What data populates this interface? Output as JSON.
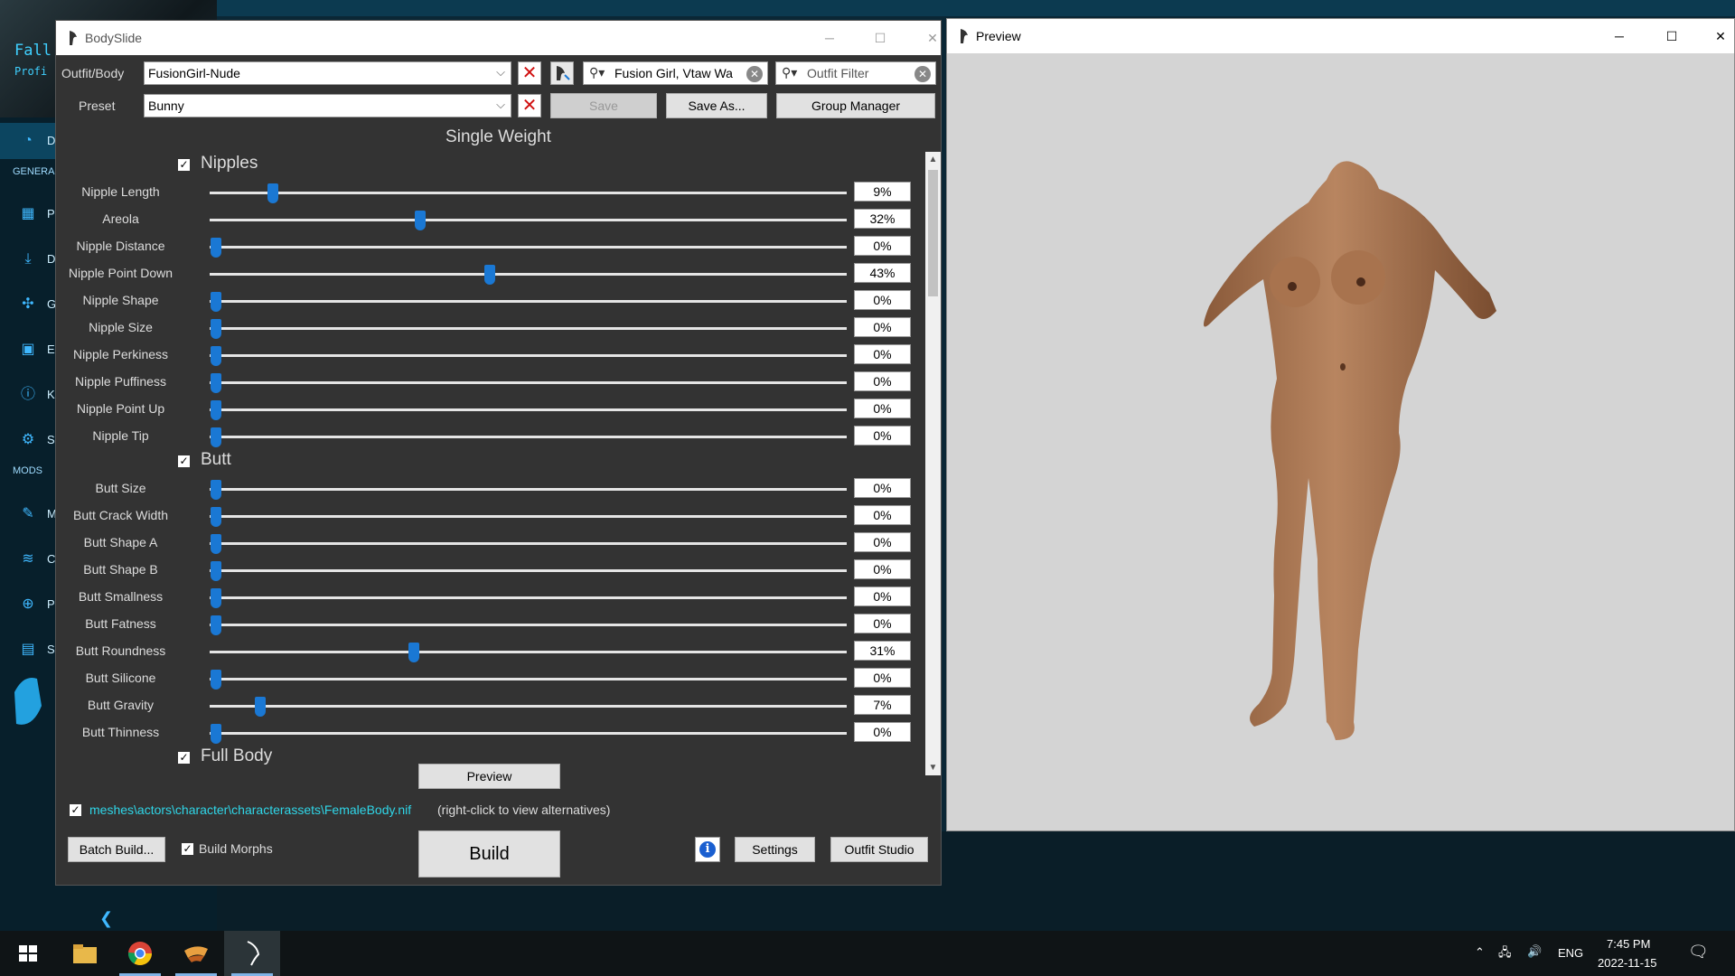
{
  "background_app": {
    "title": "Fall",
    "subtitle": "Profi",
    "active_item": "D",
    "section_general": "GENERA",
    "section_mods": "MODS",
    "items_general": [
      "P",
      "D",
      "G",
      "E",
      "K",
      "S"
    ],
    "items_mods": [
      "M",
      "C",
      "P",
      "S"
    ]
  },
  "bodyslide": {
    "title": "BodySlide",
    "outfit_label": "Outfit/Body",
    "outfit_value": "FusionGirl-Nude",
    "preset_label": "Preset",
    "preset_value": "Bunny",
    "group_filter": "Fusion Girl, Vtaw Wa",
    "outfit_filter_placeholder": "Outfit Filter",
    "save_label": "Save",
    "save_as_label": "Save As...",
    "group_manager_label": "Group Manager",
    "section_title": "Single Weight",
    "groups": [
      {
        "name": "Nipples",
        "checked": true,
        "sliders": [
          {
            "label": "Nipple Length",
            "value": 9,
            "display": "9%"
          },
          {
            "label": "Areola",
            "value": 32,
            "display": "32%"
          },
          {
            "label": "Nipple Distance",
            "value": 0,
            "display": "0%"
          },
          {
            "label": "Nipple Point Down",
            "value": 43,
            "display": "43%"
          },
          {
            "label": "Nipple Shape",
            "value": 0,
            "display": "0%"
          },
          {
            "label": "Nipple Size",
            "value": 0,
            "display": "0%"
          },
          {
            "label": "Nipple Perkiness",
            "value": 0,
            "display": "0%"
          },
          {
            "label": "Nipple Puffiness",
            "value": 0,
            "display": "0%"
          },
          {
            "label": "Nipple Point Up",
            "value": 0,
            "display": "0%"
          },
          {
            "label": "Nipple Tip",
            "value": 0,
            "display": "0%"
          }
        ]
      },
      {
        "name": "Butt",
        "checked": true,
        "sliders": [
          {
            "label": "Butt Size",
            "value": 0,
            "display": "0%"
          },
          {
            "label": "Butt Crack Width",
            "value": 0,
            "display": "0%"
          },
          {
            "label": "Butt Shape A",
            "value": 0,
            "display": "0%"
          },
          {
            "label": "Butt Shape B",
            "value": 0,
            "display": "0%"
          },
          {
            "label": "Butt Smallness",
            "value": 0,
            "display": "0%"
          },
          {
            "label": "Butt Fatness",
            "value": 0,
            "display": "0%"
          },
          {
            "label": "Butt Roundness",
            "value": 31,
            "display": "31%"
          },
          {
            "label": "Butt Silicone",
            "value": 0,
            "display": "0%"
          },
          {
            "label": "Butt Gravity",
            "value": 7,
            "display": "7%"
          },
          {
            "label": "Butt Thinness",
            "value": 0,
            "display": "0%"
          }
        ]
      },
      {
        "name": "Full Body",
        "checked": true,
        "sliders": []
      }
    ],
    "preview_label": "Preview",
    "output_path": "meshes\\actors\\character\\characterassets\\FemaleBody.nif",
    "output_hint": "(right-click to view alternatives)",
    "batch_build_label": "Batch Build...",
    "build_morphs_label": "Build Morphs",
    "build_label": "Build",
    "settings_label": "Settings",
    "outfit_studio_label": "Outfit Studio",
    "accent_color": "#1a78d4",
    "path_color": "#2fd6e8"
  },
  "preview_window": {
    "title": "Preview",
    "viewport_bg": "#d4d4d4",
    "skin_color": "#b07a52"
  },
  "taskbar": {
    "apps": [
      "windows-start-icon",
      "file-explorer-icon",
      "chrome-icon",
      "app-icon",
      "bodyslide-icon"
    ],
    "language": "ENG",
    "time": "7:45 PM",
    "date": "2022-11-15"
  }
}
